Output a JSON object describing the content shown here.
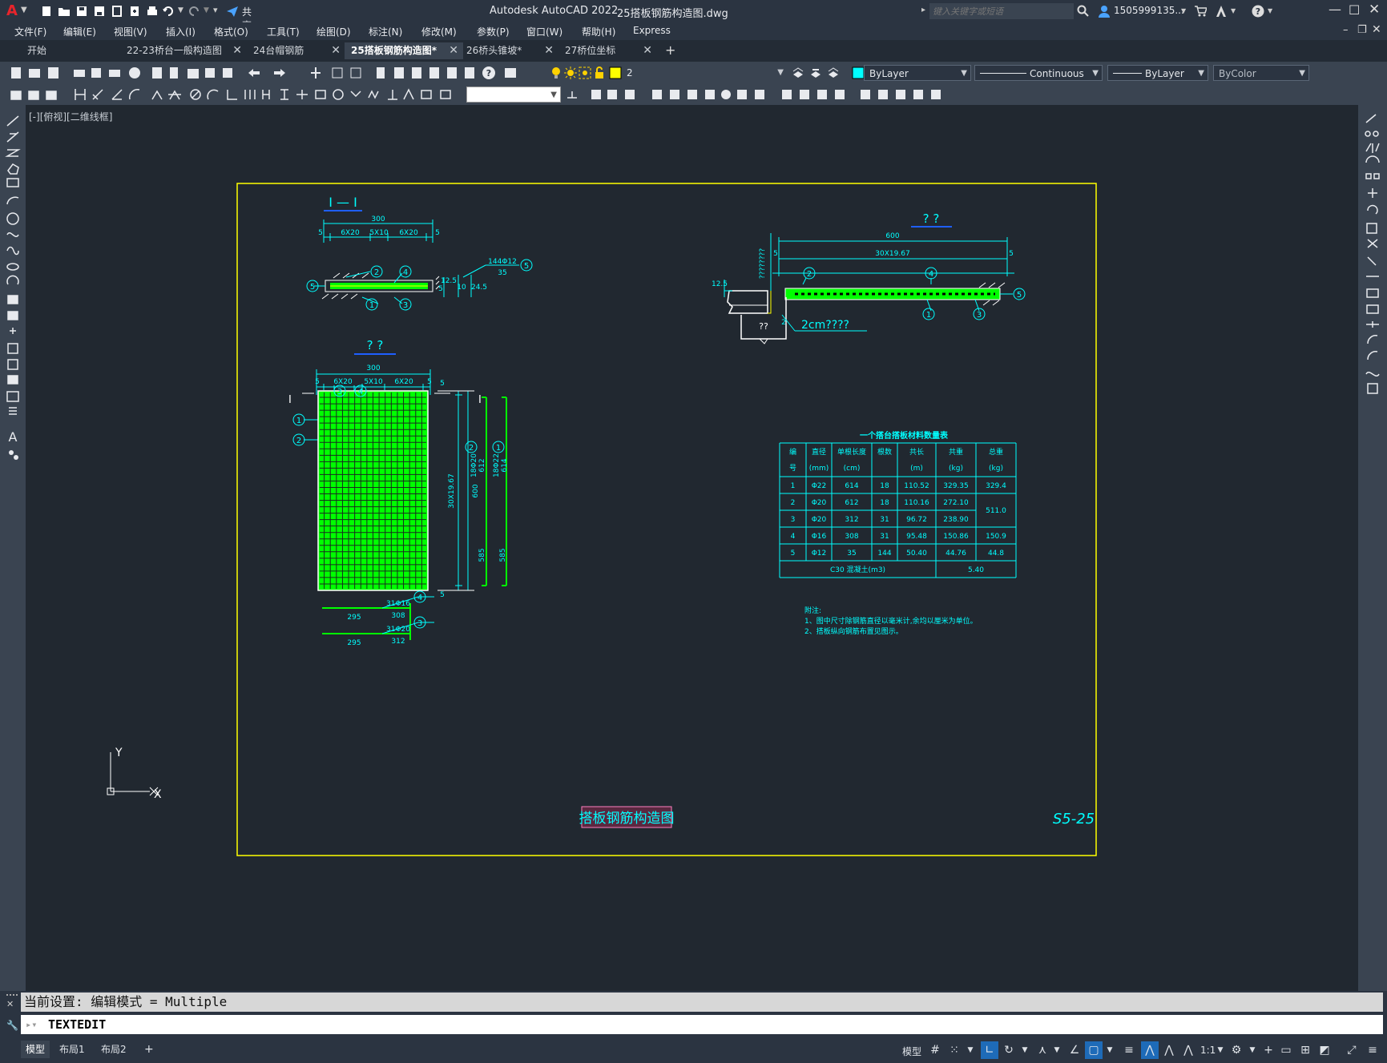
{
  "window": {
    "app_title": "Autodesk AutoCAD 2022",
    "file_title": "25搭板钢筋构造图.dwg",
    "share_label": "共享",
    "search_placeholder": "键入关键字或短语",
    "user": "1505999135...",
    "app_letter": "A"
  },
  "menu": [
    "文件(F)",
    "编辑(E)",
    "视图(V)",
    "插入(I)",
    "格式(O)",
    "工具(T)",
    "绘图(D)",
    "标注(N)",
    "修改(M)",
    "参数(P)",
    "窗口(W)",
    "帮助(H)",
    "Express"
  ],
  "tabs": [
    {
      "label": "开始",
      "closable": false,
      "active": false
    },
    {
      "label": "22-23桥台一般构造图",
      "closable": true,
      "active": false
    },
    {
      "label": "24台帽钢筋",
      "closable": true,
      "active": false
    },
    {
      "label": "25搭板钢筋构造图*",
      "closable": true,
      "active": true
    },
    {
      "label": "26桥头锥坡*",
      "closable": true,
      "active": false
    },
    {
      "label": "27桥位坐标",
      "closable": true,
      "active": false
    }
  ],
  "toolbar": {
    "layer": "2",
    "color": "ByLayer",
    "linetype": "Continuous",
    "lineweight": "ByLayer",
    "plotstyle": "ByColor"
  },
  "viewport_label": "[-][俯视][二维线框]",
  "drawing": {
    "section_title": "I — I",
    "plan_title": "? ?",
    "side_title": "? ?",
    "sheet_title": "搭板钢筋构造图",
    "sheet_number": "S5-25",
    "dims_section": {
      "total": "300",
      "d1": "6X20",
      "d2": "5X10",
      "d3": "6X20",
      "edge": "5",
      "edge2": "5",
      "rebar": "144Φ12",
      "len": "35",
      "h1": "5",
      "h2": "12.5",
      "h3": "24.5",
      "w": "10"
    },
    "dims_side": {
      "total": "600",
      "spacing": "30X19.67",
      "edge": "5",
      "edge2": "5",
      "vert": "????????",
      "note": "2cm????",
      "box": "??",
      "small": "12.5",
      "small2": "2"
    },
    "dims_plan": {
      "total": "300",
      "d1": "6X20",
      "d2": "5X10",
      "d3": "6X20",
      "edge": "5",
      "edge2": "5",
      "spacing": "30X19.67",
      "h": "600",
      "r1": "18Φ20",
      "r1len": "612",
      "r2": "18Φ22",
      "r2len": "614",
      "r1b": "585",
      "r2b": "585",
      "top": "5",
      "bot": "5",
      "b1": "31Φ16",
      "b1len": "308",
      "b1a": "295",
      "b2": "31Φ20",
      "b2len": "312",
      "b2a": "295",
      "left_I": "I",
      "right_I": "I"
    },
    "callouts": [
      "1",
      "2",
      "3",
      "4",
      "5"
    ],
    "notes": [
      "附注:",
      "1、图中尺寸除钢筋直径以毫米计,余均以厘米为单位。",
      "2、搭板纵向钢筋布置见图示。"
    ]
  },
  "qty_table": {
    "title": "一个搭台搭板材料数量表",
    "headers": [
      [
        "编",
        "直径",
        "单根长度",
        "根数",
        "共长",
        "共重",
        "总重"
      ],
      [
        "号",
        "(mm)",
        "(cm)",
        "",
        "(m)",
        "(kg)",
        "(kg)"
      ]
    ],
    "rows": [
      [
        "1",
        "Φ22",
        "614",
        "18",
        "110.52",
        "329.35",
        "329.4"
      ],
      [
        "2",
        "Φ20",
        "612",
        "18",
        "110.16",
        "272.10",
        ""
      ],
      [
        "3",
        "Φ20",
        "312",
        "31",
        "96.72",
        "238.90",
        ""
      ],
      [
        "4",
        "Φ16",
        "308",
        "31",
        "95.48",
        "150.86",
        "150.9"
      ],
      [
        "5",
        "Φ12",
        "35",
        "144",
        "50.40",
        "44.76",
        "44.8"
      ]
    ],
    "merged_total": "511.0",
    "concrete_label": "C30 混凝土(m3)",
    "concrete_value": "5.40"
  },
  "ucs": {
    "x": "X",
    "y": "Y"
  },
  "command": {
    "history": "当前设置: 编辑模式 = Multiple",
    "current": "TEXTEDIT"
  },
  "status": {
    "layout_tabs": [
      "模型",
      "布局1",
      "布局2"
    ],
    "mode": "模型",
    "scale": "1:1"
  },
  "colors": {
    "accent": "#00ffff",
    "rebar": "#00ff00",
    "frame": "#ffff00",
    "white": "#ffffff",
    "blue": "#1f5fff"
  }
}
